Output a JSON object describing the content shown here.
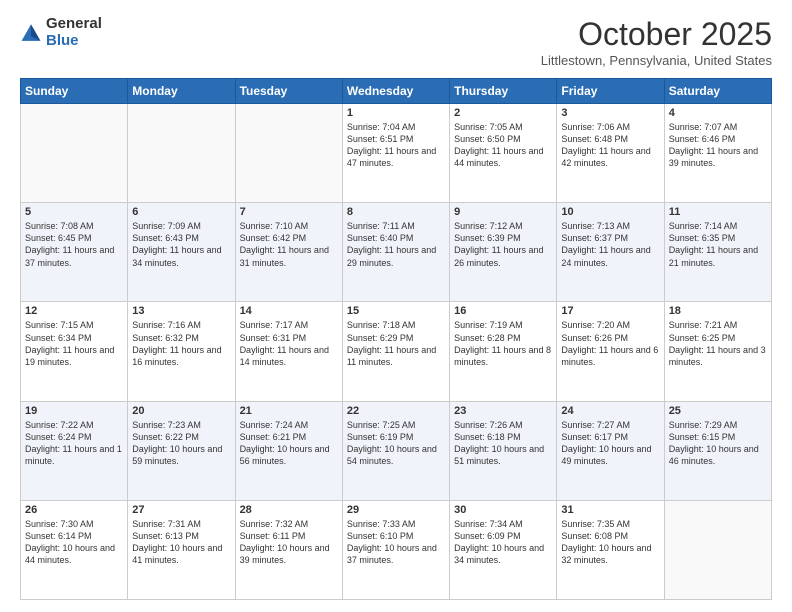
{
  "header": {
    "logo_general": "General",
    "logo_blue": "Blue",
    "month": "October 2025",
    "location": "Littlestown, Pennsylvania, United States"
  },
  "days_of_week": [
    "Sunday",
    "Monday",
    "Tuesday",
    "Wednesday",
    "Thursday",
    "Friday",
    "Saturday"
  ],
  "weeks": [
    [
      {
        "day": "",
        "info": ""
      },
      {
        "day": "",
        "info": ""
      },
      {
        "day": "",
        "info": ""
      },
      {
        "day": "1",
        "info": "Sunrise: 7:04 AM\nSunset: 6:51 PM\nDaylight: 11 hours and 47 minutes."
      },
      {
        "day": "2",
        "info": "Sunrise: 7:05 AM\nSunset: 6:50 PM\nDaylight: 11 hours and 44 minutes."
      },
      {
        "day": "3",
        "info": "Sunrise: 7:06 AM\nSunset: 6:48 PM\nDaylight: 11 hours and 42 minutes."
      },
      {
        "day": "4",
        "info": "Sunrise: 7:07 AM\nSunset: 6:46 PM\nDaylight: 11 hours and 39 minutes."
      }
    ],
    [
      {
        "day": "5",
        "info": "Sunrise: 7:08 AM\nSunset: 6:45 PM\nDaylight: 11 hours and 37 minutes."
      },
      {
        "day": "6",
        "info": "Sunrise: 7:09 AM\nSunset: 6:43 PM\nDaylight: 11 hours and 34 minutes."
      },
      {
        "day": "7",
        "info": "Sunrise: 7:10 AM\nSunset: 6:42 PM\nDaylight: 11 hours and 31 minutes."
      },
      {
        "day": "8",
        "info": "Sunrise: 7:11 AM\nSunset: 6:40 PM\nDaylight: 11 hours and 29 minutes."
      },
      {
        "day": "9",
        "info": "Sunrise: 7:12 AM\nSunset: 6:39 PM\nDaylight: 11 hours and 26 minutes."
      },
      {
        "day": "10",
        "info": "Sunrise: 7:13 AM\nSunset: 6:37 PM\nDaylight: 11 hours and 24 minutes."
      },
      {
        "day": "11",
        "info": "Sunrise: 7:14 AM\nSunset: 6:35 PM\nDaylight: 11 hours and 21 minutes."
      }
    ],
    [
      {
        "day": "12",
        "info": "Sunrise: 7:15 AM\nSunset: 6:34 PM\nDaylight: 11 hours and 19 minutes."
      },
      {
        "day": "13",
        "info": "Sunrise: 7:16 AM\nSunset: 6:32 PM\nDaylight: 11 hours and 16 minutes."
      },
      {
        "day": "14",
        "info": "Sunrise: 7:17 AM\nSunset: 6:31 PM\nDaylight: 11 hours and 14 minutes."
      },
      {
        "day": "15",
        "info": "Sunrise: 7:18 AM\nSunset: 6:29 PM\nDaylight: 11 hours and 11 minutes."
      },
      {
        "day": "16",
        "info": "Sunrise: 7:19 AM\nSunset: 6:28 PM\nDaylight: 11 hours and 8 minutes."
      },
      {
        "day": "17",
        "info": "Sunrise: 7:20 AM\nSunset: 6:26 PM\nDaylight: 11 hours and 6 minutes."
      },
      {
        "day": "18",
        "info": "Sunrise: 7:21 AM\nSunset: 6:25 PM\nDaylight: 11 hours and 3 minutes."
      }
    ],
    [
      {
        "day": "19",
        "info": "Sunrise: 7:22 AM\nSunset: 6:24 PM\nDaylight: 11 hours and 1 minute."
      },
      {
        "day": "20",
        "info": "Sunrise: 7:23 AM\nSunset: 6:22 PM\nDaylight: 10 hours and 59 minutes."
      },
      {
        "day": "21",
        "info": "Sunrise: 7:24 AM\nSunset: 6:21 PM\nDaylight: 10 hours and 56 minutes."
      },
      {
        "day": "22",
        "info": "Sunrise: 7:25 AM\nSunset: 6:19 PM\nDaylight: 10 hours and 54 minutes."
      },
      {
        "day": "23",
        "info": "Sunrise: 7:26 AM\nSunset: 6:18 PM\nDaylight: 10 hours and 51 minutes."
      },
      {
        "day": "24",
        "info": "Sunrise: 7:27 AM\nSunset: 6:17 PM\nDaylight: 10 hours and 49 minutes."
      },
      {
        "day": "25",
        "info": "Sunrise: 7:29 AM\nSunset: 6:15 PM\nDaylight: 10 hours and 46 minutes."
      }
    ],
    [
      {
        "day": "26",
        "info": "Sunrise: 7:30 AM\nSunset: 6:14 PM\nDaylight: 10 hours and 44 minutes."
      },
      {
        "day": "27",
        "info": "Sunrise: 7:31 AM\nSunset: 6:13 PM\nDaylight: 10 hours and 41 minutes."
      },
      {
        "day": "28",
        "info": "Sunrise: 7:32 AM\nSunset: 6:11 PM\nDaylight: 10 hours and 39 minutes."
      },
      {
        "day": "29",
        "info": "Sunrise: 7:33 AM\nSunset: 6:10 PM\nDaylight: 10 hours and 37 minutes."
      },
      {
        "day": "30",
        "info": "Sunrise: 7:34 AM\nSunset: 6:09 PM\nDaylight: 10 hours and 34 minutes."
      },
      {
        "day": "31",
        "info": "Sunrise: 7:35 AM\nSunset: 6:08 PM\nDaylight: 10 hours and 32 minutes."
      },
      {
        "day": "",
        "info": ""
      }
    ]
  ]
}
